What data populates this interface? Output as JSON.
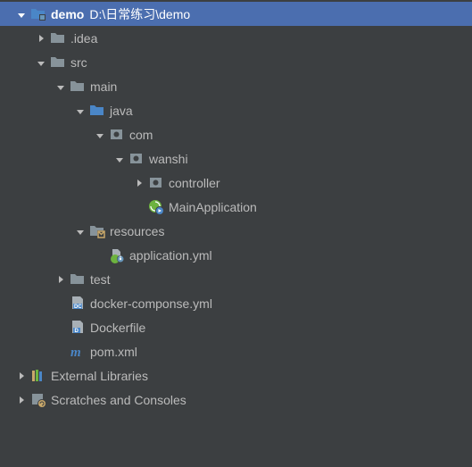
{
  "tree": {
    "demo": {
      "label": "demo",
      "path": "D:\\日常练习\\demo"
    },
    "idea": {
      "label": ".idea"
    },
    "src": {
      "label": "src"
    },
    "main": {
      "label": "main"
    },
    "java": {
      "label": "java"
    },
    "com": {
      "label": "com"
    },
    "wanshi": {
      "label": "wanshi"
    },
    "controller": {
      "label": "controller"
    },
    "mainApp": {
      "label": "MainApplication"
    },
    "resources": {
      "label": "resources"
    },
    "appYml": {
      "label": "application.yml"
    },
    "test": {
      "label": "test"
    },
    "dockerCompose": {
      "label": "docker-componse.yml"
    },
    "dockerfile": {
      "label": "Dockerfile"
    },
    "pom": {
      "label": "pom.xml"
    },
    "extLib": {
      "label": "External Libraries"
    },
    "scratches": {
      "label": "Scratches and Consoles"
    }
  }
}
